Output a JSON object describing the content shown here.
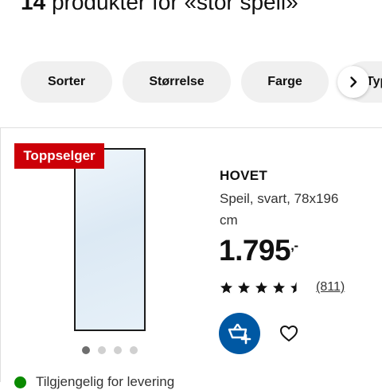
{
  "search": {
    "count": "14",
    "results_text": "produkter for «stor speil»"
  },
  "filters": [
    {
      "label": "Sorter"
    },
    {
      "label": "Størrelse"
    },
    {
      "label": "Farge"
    },
    {
      "label": "Typ"
    }
  ],
  "product": {
    "badge": "Toppselger",
    "name": "HOVET",
    "description": "Speil, svart, 78x196 cm",
    "price": "1.795",
    "price_suffix": ",-",
    "rating": 4.5,
    "review_count": "(811)",
    "image_dots": {
      "total": 4,
      "active": 1
    },
    "stock_text": "Tilgjengelig for levering"
  },
  "colors": {
    "badge": "#cc0008",
    "cart_button": "#0058a3",
    "stock": "#0a8a00"
  },
  "icons": {
    "scroll": "chevron-right-icon",
    "cart": "add-to-cart-icon",
    "favourite": "heart-icon",
    "star": "star-icon"
  }
}
